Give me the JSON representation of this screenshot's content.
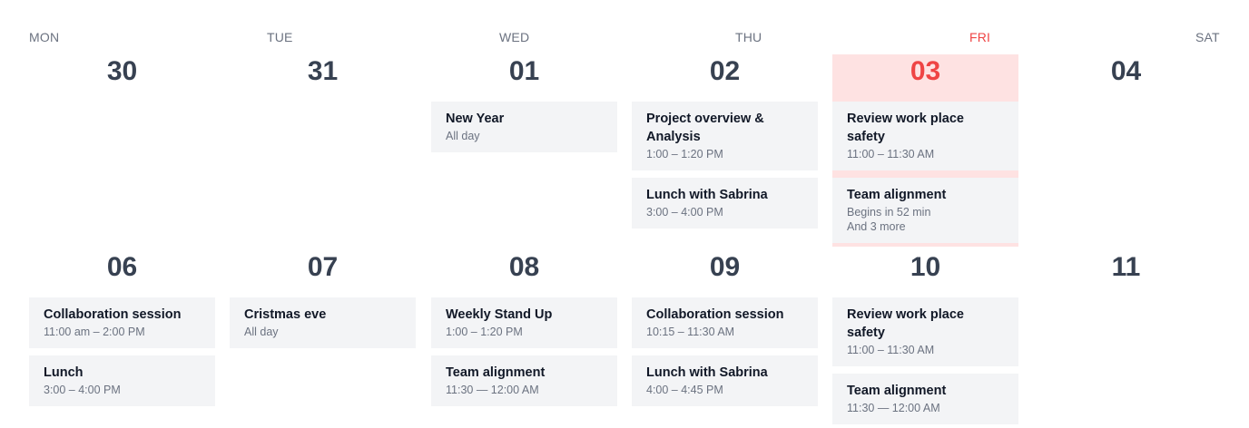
{
  "week1": {
    "days": [
      {
        "dow": "MON",
        "date": "30"
      },
      {
        "dow": "TUE",
        "date": "31"
      },
      {
        "dow": "WED",
        "date": "01",
        "events": [
          {
            "title": "New Year",
            "time": "All day"
          }
        ]
      },
      {
        "dow": "THU",
        "date": "02",
        "events": [
          {
            "title": "Project overview & Analysis",
            "time": "1:00 – 1:20 PM"
          },
          {
            "title": "Lunch with Sabrina",
            "time": "3:00 – 4:00 PM"
          }
        ]
      },
      {
        "dow": "FRI",
        "date": "03",
        "today": true,
        "events": [
          {
            "title": "Review work place safety",
            "time": "11:00 – 11:30 AM"
          },
          {
            "title": "Team alignment",
            "time": "Begins in 52 min",
            "extra": "And 3 more"
          }
        ]
      },
      {
        "dow": "SAT",
        "date": "04"
      }
    ]
  },
  "week2": {
    "days": [
      {
        "date": "06",
        "events": [
          {
            "title": "Collaboration session",
            "time": "11:00 am – 2:00 PM"
          },
          {
            "title": "Lunch",
            "time": "3:00 – 4:00 PM"
          }
        ]
      },
      {
        "date": "07",
        "events": [
          {
            "title": "Cristmas eve",
            "time": "All day"
          }
        ]
      },
      {
        "date": "08",
        "events": [
          {
            "title": "Weekly Stand Up",
            "time": "1:00 – 1:20 PM"
          },
          {
            "title": "Team alignment",
            "time": "11:30 — 12:00 AM"
          }
        ]
      },
      {
        "date": "09",
        "events": [
          {
            "title": "Collaboration session",
            "time": "10:15 – 11:30 AM"
          },
          {
            "title": "Lunch with Sabrina",
            "time": "4:00 – 4:45 PM"
          }
        ]
      },
      {
        "date": "10",
        "events": [
          {
            "title": "Review work place safety",
            "time": "11:00 – 11:30 AM"
          },
          {
            "title": "Team alignment",
            "time": "11:30 — 12:00 AM"
          }
        ]
      },
      {
        "date": "11"
      }
    ]
  },
  "colors": {
    "today_accent": "#ef4444",
    "today_bg": "#fee2e2",
    "event_bg": "#f3f4f6"
  }
}
